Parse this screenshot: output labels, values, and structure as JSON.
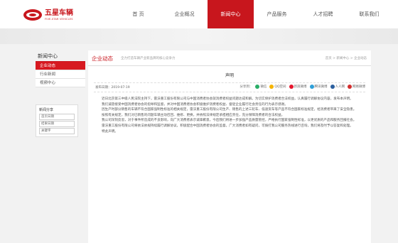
{
  "header": {
    "logo_cn": "五星车辆",
    "logo_en": "FIVE-STAR VEHICLES",
    "nav": [
      {
        "label": "首 页",
        "active": false
      },
      {
        "label": "企业概况",
        "active": false
      },
      {
        "label": "新闻中心",
        "active": true
      },
      {
        "label": "产品服务",
        "active": false
      },
      {
        "label": "人才招聘",
        "active": false
      },
      {
        "label": "联系我们",
        "active": false
      }
    ]
  },
  "sidebar": {
    "title": "新闻中心",
    "items": [
      {
        "label": "企业动态",
        "active": true
      },
      {
        "label": "行业新闻",
        "active": false
      },
      {
        "label": "视频中心",
        "active": false
      }
    ]
  },
  "share_box": {
    "title": "新闻分享",
    "inputs": [
      "首页日期",
      "结果日期",
      "关键字"
    ],
    "search_label": "搜索"
  },
  "content": {
    "title": "企业动态",
    "subtitle": "全力打造车辆产业新品牌的核心竞争力",
    "breadcrumb": "首页 > 新闻中心 > 企业动态",
    "article_title": "声明",
    "publish_date": "发布日期：2019-07-19",
    "share_items": [
      {
        "label": "分享到：",
        "icon": "share-label",
        "color": ""
      },
      {
        "label": "微信",
        "icon": "wechat-icon",
        "color": "#2aae67"
      },
      {
        "label": "QQ空间",
        "icon": "qzone-icon",
        "color": "#f5b400"
      },
      {
        "label": "新浪微博",
        "icon": "weibo-icon",
        "color": "#e6162d"
      },
      {
        "label": "腾讯微博",
        "icon": "tencent-weibo-icon",
        "color": "#2e9fd8"
      },
      {
        "label": "人人网",
        "icon": "renren-icon",
        "color": "#2c5f9e"
      },
      {
        "label": "网易微博",
        "icon": "netease-icon",
        "color": "#d22e2e"
      }
    ],
    "paragraphs": [
      "近日北京第三中级人民法院主持下，雷沃重工股份有限公司与中国消费者协会就消费者权益问题达成和解。为切实保护消费者合法权益，认真履行调解协议内容，发布本声明。",
      "我们诚恳接受中国消费者协会的指导和监督，并对中国消费者协会积极维护消费者权益、督促企业履行社会责任的行为表示感谢。",
      "因生产时部分销售的车辆不符合国家强制性标准的相关规定，雷沃重工股份有限公司生产、销售的上述三轮车、低速货车等产品不符合国家标准规定，给消费者带来了安全隐患。",
      "按照有关规定，我们对已销售的问题车辆主动召回、维修、更换，并依照法律规定承担相应责任，充分保障消费者的合法权益。",
      "我公司深刻反思，对于事件所造成的不良影响，向广大消费者表示诚挚歉意。今后我们将进一步加强产品质量管控，严格执行国家强制性标准，以更优质的产品和服务回报社会。",
      "雷沃重工股份有限公司将依法依规持续履行调解协议，积极配合中国消费者协会的监督。广大消费者如有疑问，可拨打我公司服务热线进行咨询，我们将及时予以答复和处理。",
      "特此声明。"
    ]
  }
}
